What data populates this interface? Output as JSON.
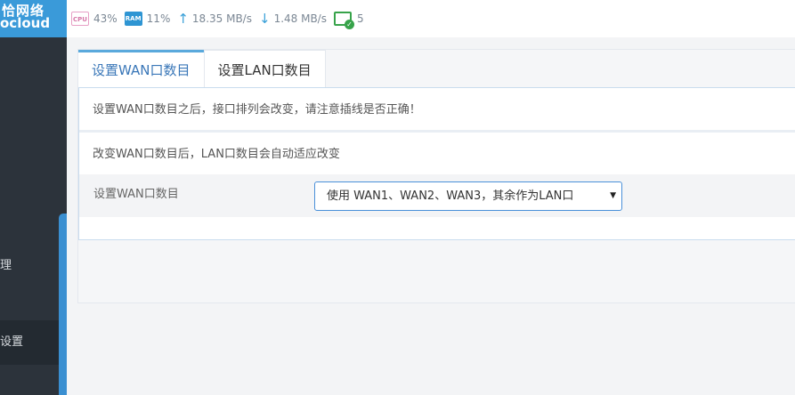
{
  "sidebar": {
    "logo_line1": "恰网络",
    "logo_line2": "ocloud",
    "items": [
      {
        "label": "理"
      },
      {
        "label": "设置"
      }
    ]
  },
  "status": {
    "cpu_chip": "CPU",
    "cpu": "43%",
    "ram_chip": "RAM",
    "ram": "11%",
    "upload": "18.35 MB/s",
    "download": "1.48 MB/s",
    "devices": "5"
  },
  "tabs": [
    {
      "label": "设置WAN口数目",
      "active": true
    },
    {
      "label": "设置LAN口数目",
      "active": false
    }
  ],
  "content": {
    "notice": "设置WAN口数目之后，接口排列会改变，请注意插线是否正确！",
    "hint": "改变WAN口数目后，LAN口数目会自动适应改变",
    "field_label": "设置WAN口数目",
    "select_value": "使用 WAN1、WAN2、WAN3，其余作为LAN口"
  },
  "colors": {
    "accent": "#3a9ad9",
    "sidebar_bg": "#2c333b",
    "select_border": "#4a90d9"
  }
}
